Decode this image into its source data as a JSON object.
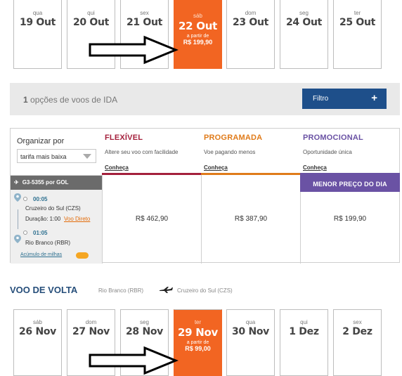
{
  "outbound_dates": [
    {
      "dow": "qua",
      "day": "19 Out"
    },
    {
      "dow": "qui",
      "day": "20 Out"
    },
    {
      "dow": "sex",
      "day": "21 Out"
    },
    {
      "dow": "sáb",
      "day": "22 Out",
      "from": "a partir de",
      "price": "R$ 199,90"
    },
    {
      "dow": "dom",
      "day": "23 Out"
    },
    {
      "dow": "seg",
      "day": "24 Out"
    },
    {
      "dow": "ter",
      "day": "25 Out"
    }
  ],
  "ida": {
    "count": "1",
    "title_rest": "opções de voos de IDA",
    "filter_label": "Filtro",
    "filter_icon": "+"
  },
  "sort": {
    "label": "Organizar por",
    "value": "tarifa mais baixa"
  },
  "fares": [
    {
      "name": "FLEXÍVEL",
      "desc": "Altere seu voo com facilidade",
      "link": "Conheça",
      "color": "#a4203c",
      "price": "R$ 462,90"
    },
    {
      "name": "PROGRAMADA",
      "desc": "Voe pagando menos",
      "link": "Conheça",
      "color": "#e07b1a",
      "price": "R$ 387,90"
    },
    {
      "name": "PROMOCIONAL",
      "desc": "Oportunidade única",
      "link": "Conheça",
      "color": "#6a52a4",
      "price": "R$ 199,90",
      "badge": "MENOR  PREÇO DO DIA"
    }
  ],
  "flight": {
    "number": "G3-5355 por  GOL",
    "dep_time": "00:05",
    "dep_city": "Cruzeiro do Sul (CZS)",
    "duration_label": "Duração: 1:00",
    "direct": "Voo Direto",
    "arr_time": "01:05",
    "arr_city": "Rio Branco (RBR)",
    "miles": "Acúmulo de milhas"
  },
  "volta": {
    "title": "VOO DE VOLTA",
    "from": "Rio Branco  (RBR)",
    "to": "Cruzeiro do Sul  (CZS)"
  },
  "return_dates": [
    {
      "dow": "sáb",
      "day": "26 Nov"
    },
    {
      "dow": "dom",
      "day": "27 Nov"
    },
    {
      "dow": "seg",
      "day": "28 Nov"
    },
    {
      "dow": "ter",
      "day": "29 Nov",
      "from": "a partir de",
      "price": "R$ 99,00"
    },
    {
      "dow": "qua",
      "day": "30 Nov"
    },
    {
      "dow": "qui",
      "day": "1 Dez"
    },
    {
      "dow": "sex",
      "day": "2 Dez"
    }
  ],
  "colors": {
    "accent": "#f26522",
    "brand_blue": "#1e4f8a",
    "promo": "#6a52a4"
  }
}
